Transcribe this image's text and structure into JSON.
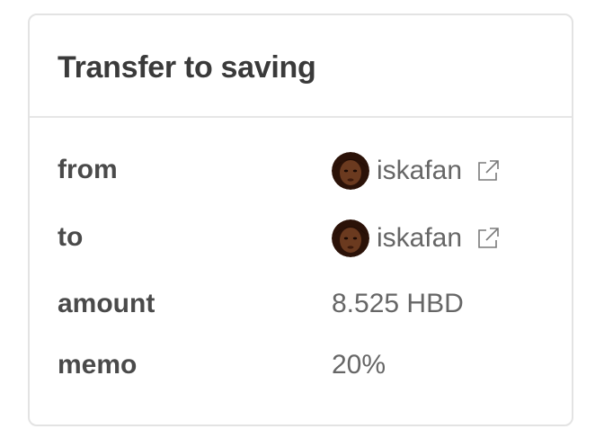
{
  "card": {
    "title": "Transfer to saving"
  },
  "rows": [
    {
      "label": "from",
      "value": "iskafan",
      "avatar": "avatar",
      "link_icon": "external-link-icon"
    },
    {
      "label": "to",
      "value": "iskafan",
      "avatar": "avatar",
      "link_icon": "external-link-icon"
    },
    {
      "label": "amount",
      "value": "8.525 HBD"
    },
    {
      "label": "memo",
      "value": "20%"
    }
  ],
  "colors": {
    "title": "#3a3a3a",
    "label": "#4a4a4a",
    "value": "#666666",
    "border": "#e3e3e3",
    "avatar_skin": "#6b3a1f",
    "avatar_hair": "#2b1208"
  }
}
